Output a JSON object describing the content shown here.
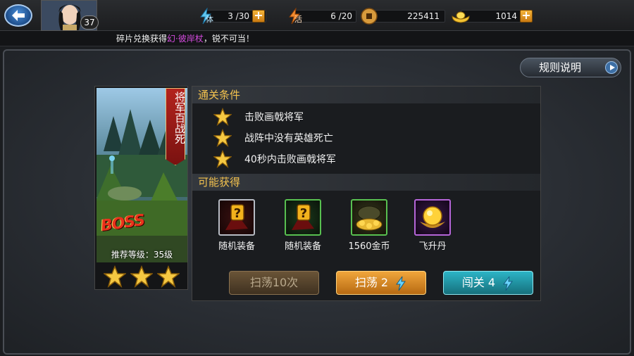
{
  "header": {
    "level": "37",
    "stamina": {
      "label": "体",
      "value": "3 /30"
    },
    "spirit": {
      "label": "活",
      "value": "6 /20"
    },
    "coins": "225411",
    "ingots": "1014"
  },
  "ticker": {
    "prefix": "碎片兑换获得",
    "highlight": "幻·彼岸杖",
    "suffix": "，锐不可当！"
  },
  "rules_label": "规则说明",
  "stage": {
    "name": "将军百战死",
    "boss_text": "BOSS",
    "recommended": "推荐等级：35级",
    "stars": 3
  },
  "conditions": {
    "title": "通关条件",
    "items": [
      "击败画戟将军",
      "战阵中没有英雄死亡",
      "40秒内击败画戟将军"
    ]
  },
  "rewards": {
    "title": "可能获得",
    "items": [
      {
        "label": "随机装备",
        "icon": "random-equipment-icon"
      },
      {
        "label": "随机装备",
        "icon": "random-equipment-icon"
      },
      {
        "label": "1560金币",
        "icon": "gold-coins-icon"
      },
      {
        "label": "飞升丹",
        "icon": "ascension-pill-icon"
      }
    ]
  },
  "buttons": {
    "sweep10": "扫荡10次",
    "sweep": "扫荡 2",
    "challenge": "闯关 4"
  },
  "colors": {
    "section_title": "#f3c24f",
    "sweep_button": "#f0a63c",
    "challenge_button": "#2cb4c6",
    "ticker_highlight": "#d64be0"
  }
}
